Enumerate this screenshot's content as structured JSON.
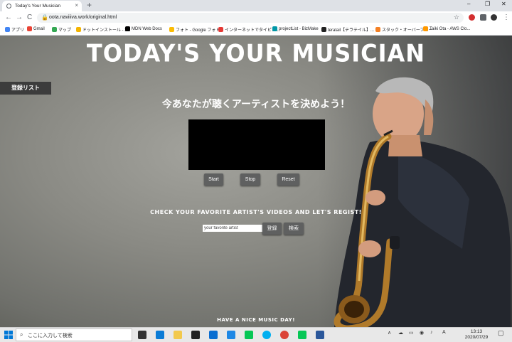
{
  "browser": {
    "tab_title": "Today's Your Musician",
    "tab_close": "×",
    "new_tab": "+",
    "url": "oota.naviiiva.work/original.html",
    "window_controls": [
      "–",
      "❐",
      "✕"
    ],
    "nav": {
      "back": "←",
      "forward": "→",
      "reload": "C"
    },
    "star": "☆",
    "bookmarks": [
      {
        "label": "アプリ",
        "color": "#4285f4"
      },
      {
        "label": "Gmail",
        "color": "#ea4335"
      },
      {
        "label": "マップ",
        "color": "#34a853"
      },
      {
        "label": "ドットインストール - 3...",
        "color": "#f4b400"
      },
      {
        "label": "MDN Web Docs",
        "color": "#000000"
      },
      {
        "label": "フォト - Google フォト",
        "color": "#fbbc04"
      },
      {
        "label": "インターネットでタイピン...",
        "color": "#e53935"
      },
      {
        "label": "projectList - BizMake",
        "color": "#0097a7"
      },
      {
        "label": "teratail【テラテイル】...",
        "color": "#222222"
      },
      {
        "label": "スタック・オーバーフロー",
        "color": "#f48024"
      },
      {
        "label": "Taiki Ota - AWS Clo...",
        "color": "#ff9900"
      }
    ]
  },
  "page": {
    "title": "TODAY'S YOUR MUSICIAN",
    "list_button": "登録リスト",
    "subtitle": "今あなたが聴くアーティストを決めよう！",
    "controls": {
      "start": "Start",
      "stop": "Stop",
      "reset": "Reset"
    },
    "regist_heading": "CHECK YOUR FAVORITE ARTIST'S VIDEOS AND LET'S REGIST!",
    "artist_input_value": "your favorite artist",
    "register_button": "登録",
    "search_button": "検索",
    "footer": "HAVE A NICE MUSIC DAY!"
  },
  "taskbar": {
    "search_placeholder": "ここに入力して検索",
    "search_icon": "⌕",
    "apps": [
      {
        "name": "task-view",
        "color": "#333333"
      },
      {
        "name": "edge",
        "color": "#0a7cd6"
      },
      {
        "name": "explorer",
        "color": "#f2c94c"
      },
      {
        "name": "store",
        "color": "#222222"
      },
      {
        "name": "mail",
        "color": "#0a6ed1"
      },
      {
        "name": "phone",
        "color": "#1e88e5"
      },
      {
        "name": "line",
        "color": "#06c755"
      },
      {
        "name": "skype",
        "color": "#00aff0"
      },
      {
        "name": "chrome",
        "color": "#db4437"
      },
      {
        "name": "line2",
        "color": "#06c755"
      },
      {
        "name": "word",
        "color": "#2b579a"
      }
    ],
    "tray_icons": [
      "∧",
      "☁",
      "▭",
      "◉",
      "♪",
      "A"
    ],
    "time": "13:13",
    "date": "2020/07/29"
  }
}
